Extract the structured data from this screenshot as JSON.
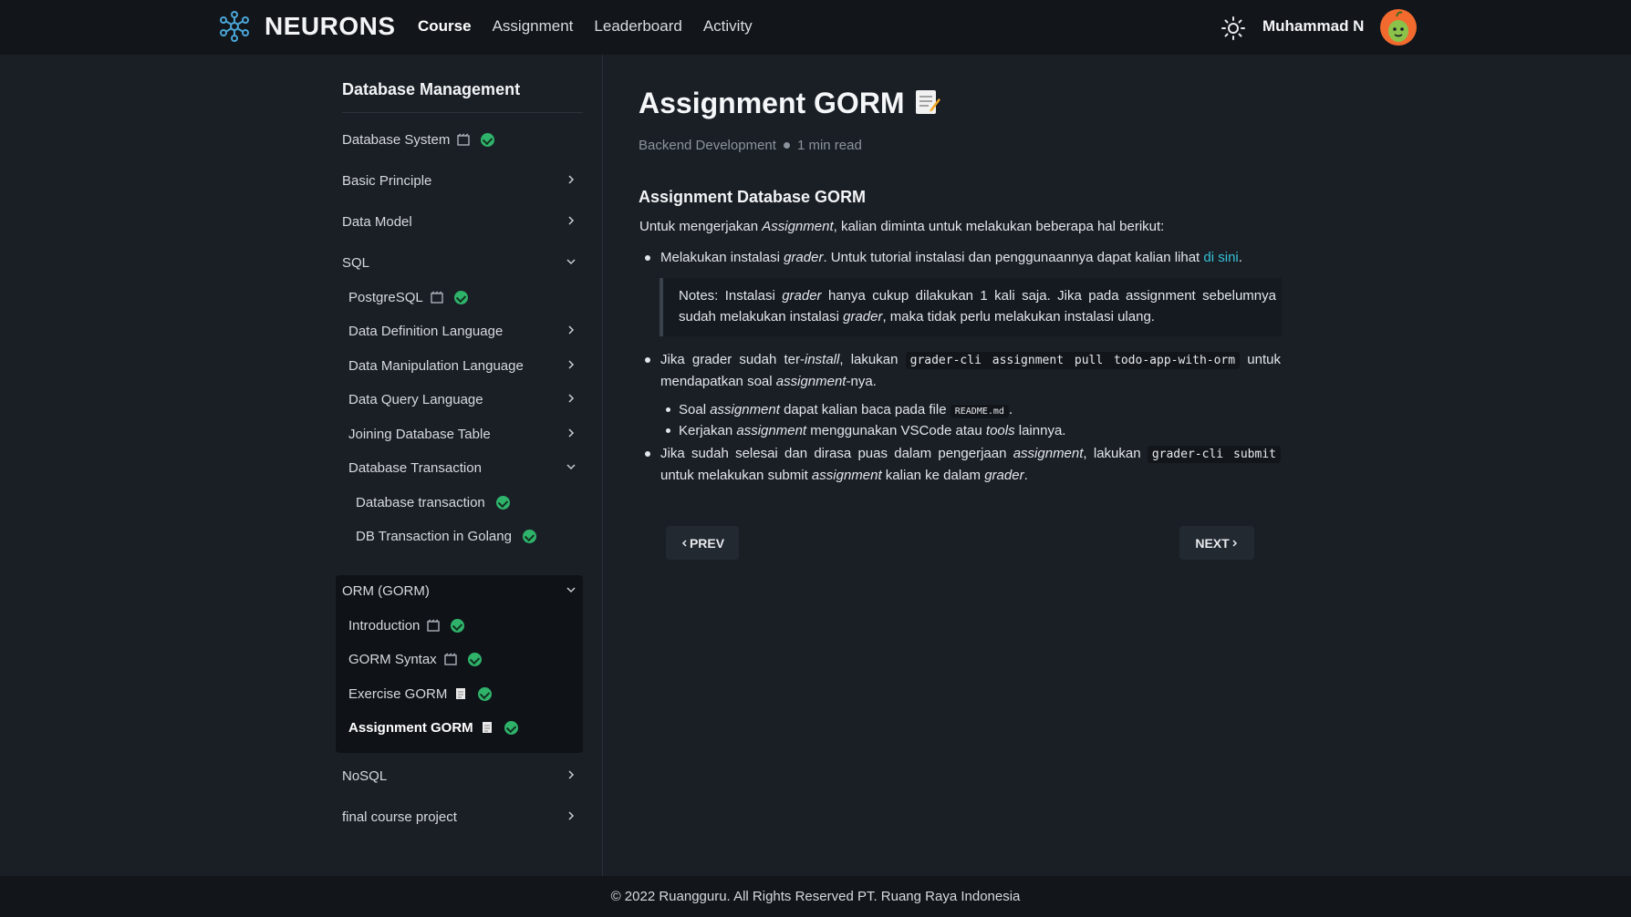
{
  "header": {
    "brand": "NEURONS",
    "nav": [
      {
        "label": "Course",
        "active": true
      },
      {
        "label": "Assignment",
        "active": false
      },
      {
        "label": "Leaderboard",
        "active": false
      },
      {
        "label": "Activity",
        "active": false
      }
    ],
    "user_name": "Muhammad N"
  },
  "sidebar": {
    "title": "Database Management",
    "items": {
      "database_system": "Database System",
      "basic_principle": "Basic Principle",
      "data_model": "Data Model",
      "sql": "SQL",
      "postgresql": "PostgreSQL",
      "ddl": "Data Definition Language",
      "dml": "Data Manipulation Language",
      "dql": "Data Query Language",
      "joining": "Joining Database Table",
      "db_transaction_group": "Database Transaction",
      "db_transaction": "Database transaction",
      "db_transaction_golang": "DB Transaction in Golang",
      "orm": "ORM (GORM)",
      "introduction": "Introduction",
      "gorm_syntax": "GORM Syntax",
      "exercise_gorm": "Exercise GORM",
      "assignment_gorm": "Assignment GORM",
      "nosql": "NoSQL",
      "final_project": "final course project"
    }
  },
  "main": {
    "title": "Assignment GORM",
    "category": "Backend Development",
    "read_time": "1 min read",
    "heading": "Assignment Database GORM",
    "intro_a": "Untuk mengerjakan ",
    "intro_em": "Assignment",
    "intro_b": ", kalian diminta untuk melakukan beberapa hal berikut:",
    "b1_a": "Melakukan instalasi ",
    "b1_em": "grader",
    "b1_b": ". Untuk tutorial instalasi dan penggunaannya dapat kalian lihat ",
    "b1_link": "di sini",
    "b1_c": ".",
    "note_a": "Notes: Instalasi ",
    "note_em1": "grader",
    "note_b": " hanya cukup dilakukan 1 kali saja. Jika pada assignment sebelumnya sudah melakukan instalasi ",
    "note_em2": "grader",
    "note_c": ", maka tidak perlu melakukan instalasi ulang.",
    "b2_a": "Jika grader sudah ter-",
    "b2_em1": "install",
    "b2_b": ", lakukan ",
    "b2_code": "grader-cli assignment pull todo-app-with-orm",
    "b2_c": " untuk mendapatkan soal ",
    "b2_em2": "assignment",
    "b2_d": "-nya.",
    "s1_a": "Soal ",
    "s1_em": "assignment",
    "s1_b": " dapat kalian baca pada file ",
    "s1_code": "README.md",
    "s1_c": ".",
    "s2_a": "Kerjakan ",
    "s2_em1": "assignment",
    "s2_b": " menggunakan VSCode atau ",
    "s2_em2": "tools",
    "s2_c": " lainnya.",
    "b3_a": "Jika sudah selesai dan dirasa puas dalam pengerjaan ",
    "b3_em1": "assignment",
    "b3_b": ", lakukan ",
    "b3_code": "grader-cli submit",
    "b3_c": " untuk melakukan submit ",
    "b3_em2": "assignment",
    "b3_d": " kalian ke dalam ",
    "b3_em3": "grader",
    "b3_e": ".",
    "prev_label": "PREV",
    "next_label": "NEXT"
  },
  "footer": {
    "text": "© 2022 Ruangguru. All Rights Reserved PT. Ruang Raya Indonesia"
  },
  "colors": {
    "background": "#1a1f26",
    "topbar": "#12161b",
    "link": "#34c1d6",
    "check": "#2fb36b",
    "avatar": "#f26a2e"
  },
  "icons": [
    "neurons-logo-icon",
    "sun-icon",
    "avatar",
    "video-icon",
    "check-icon",
    "memo-icon",
    "chevron-right-icon",
    "chevron-down-icon",
    "chevron-left-icon"
  ]
}
